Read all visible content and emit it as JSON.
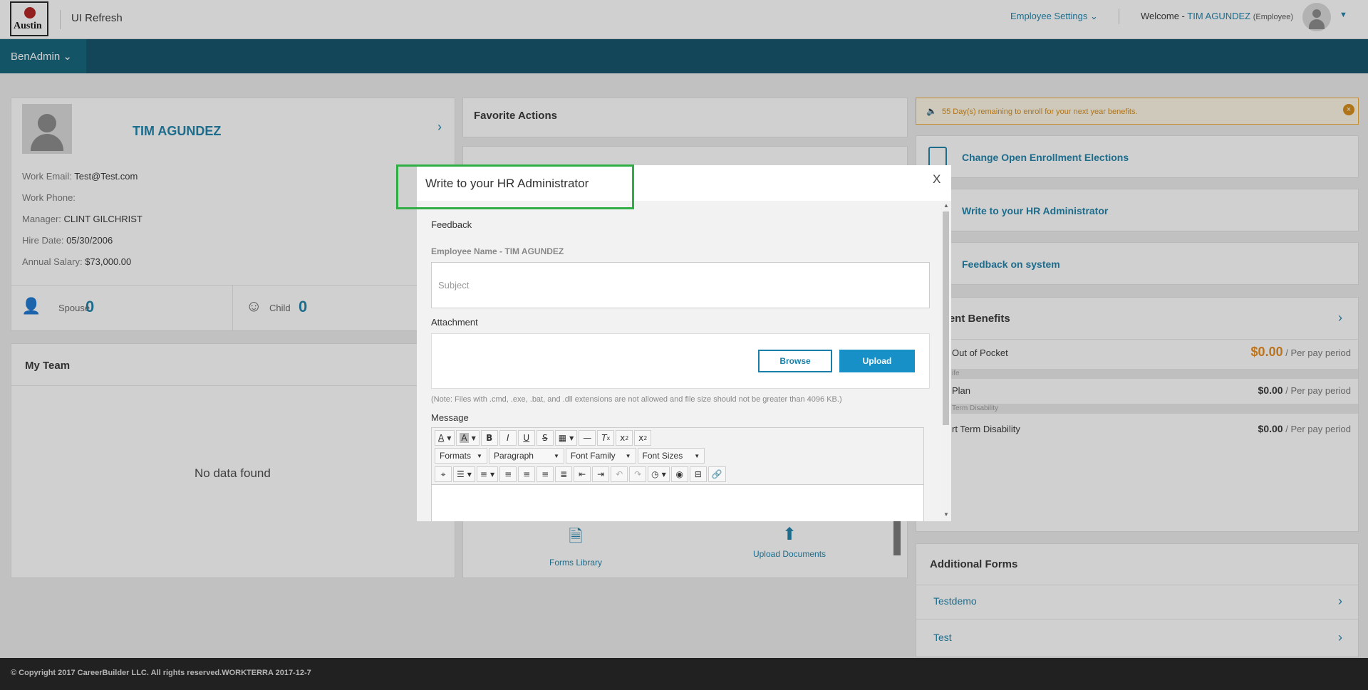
{
  "header": {
    "logo_text": "Austin",
    "app_title": "UI Refresh",
    "employee_settings": "Employee Settings",
    "welcome_prefix": "Welcome -",
    "user_name": "TIM AGUNDEZ",
    "user_role": "(Employee)"
  },
  "nav": {
    "menu": "BenAdmin"
  },
  "profile": {
    "name": "TIM AGUNDEZ",
    "work_email_label": "Work Email:",
    "work_email": "Test@Test.com",
    "work_phone_label": "Work Phone:",
    "work_phone": "",
    "manager_label": "Manager:",
    "manager": "CLINT GILCHRIST",
    "hire_date_label": "Hire Date:",
    "hire_date": "05/30/2006",
    "salary_label": "Annual Salary:",
    "salary": "$73,000.00",
    "spouse_label": "Spouse",
    "spouse_count": "0",
    "child_label": "Child",
    "child_count": "0"
  },
  "team": {
    "title": "My Team",
    "empty": "No data found"
  },
  "favorites": {
    "title": "Favorite Actions",
    "forms_library": "Forms Library",
    "upload_documents": "Upload Documents"
  },
  "alert": {
    "text": "55 Day(s) remaining to enroll for your next year benefits."
  },
  "quick_actions": [
    "Change Open Enrollment Elections",
    "Write to your HR Administrator",
    "Feedback on system"
  ],
  "benefits": {
    "title": "rent Benefits",
    "rows": [
      {
        "label": "Out of Pocket",
        "amount": "$0.00",
        "period": "/ Per pay period"
      },
      {
        "label": "Plan",
        "amount": "$0.00",
        "period": "/ Per pay period"
      },
      {
        "label": "rt Term Disability",
        "amount": "$0.00",
        "period": "/ Per pay period"
      }
    ],
    "sub1": "ife",
    "sub2": "Term Disability"
  },
  "additional_forms": {
    "title": "Additional Forms",
    "items": [
      "Testdemo",
      "Test"
    ]
  },
  "footer": {
    "text": "© Copyright 2017 CareerBuilder LLC. All rights reserved.WORKTERRA 2017-12-7"
  },
  "modal": {
    "title": "Write to your HR Administrator",
    "close": "X",
    "feedback_label": "Feedback",
    "employee_name": "Employee Name - TIM AGUNDEZ",
    "subject_placeholder": "Subject",
    "attachment_label": "Attachment",
    "browse": "Browse",
    "upload": "Upload",
    "note": "(Note: Files with .cmd, .exe, .bat, and .dll extensions are not allowed and file size should not be greater than 4096 KB.)",
    "message_label": "Message",
    "toolbar": {
      "formats": "Formats",
      "paragraph": "Paragraph",
      "font_family": "Font Family",
      "font_sizes": "Font Sizes"
    }
  },
  "colors": {
    "accent": "#1a7fa8",
    "nav": "#0c4f66",
    "highlight": "#2eae44",
    "alert": "#d68a14"
  }
}
